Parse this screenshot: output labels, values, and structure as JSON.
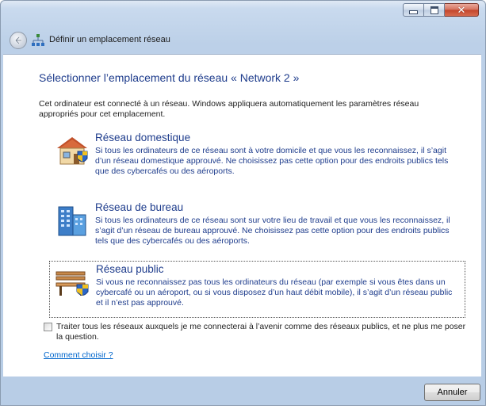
{
  "window": {
    "title": "Définir un emplacement réseau",
    "controls": {
      "minimize": "minimize-icon",
      "maximize": "maximize-icon",
      "close": "✕"
    }
  },
  "page": {
    "heading": "Sélectionner l’emplacement du réseau « Network  2 »",
    "intro": "Cet ordinateur est connecté à un réseau. Windows appliquera automatiquement les paramètres réseau appropriés pour cet emplacement."
  },
  "options": [
    {
      "title": "Réseau domestique",
      "description": "Si tous les ordinateurs de ce réseau sont à votre domicile et que vous les reconnaissez, il s’agit d’un réseau domestique approuvé. Ne choisissez pas cette option pour des endroits publics tels que des cybercafés ou des aéroports.",
      "icon": "home-network-icon"
    },
    {
      "title": "Réseau de bureau",
      "description": "Si tous les ordinateurs de ce réseau sont sur votre lieu de travail et que vous les reconnaissez, il s’agit d’un réseau de bureau approuvé. Ne choisissez pas cette option pour des endroits publics tels que des cybercafés ou des aéroports.",
      "icon": "work-network-icon"
    },
    {
      "title": "Réseau public",
      "description": "Si vous ne reconnaissez pas tous les ordinateurs du réseau (par exemple si vous êtes dans un cybercafé ou un aéroport, ou si vous disposez d’un haut débit mobile), il s’agit d’un réseau public et il n’est pas approuvé.",
      "icon": "public-network-icon",
      "focused": true
    }
  ],
  "checkbox": {
    "label": "Traiter tous les réseaux auxquels je me connecterai à l’avenir comme des réseaux publics, et ne plus me poser la question.",
    "checked": false
  },
  "help_link": "Comment choisir ?",
  "footer": {
    "cancel_label": "Annuler"
  }
}
